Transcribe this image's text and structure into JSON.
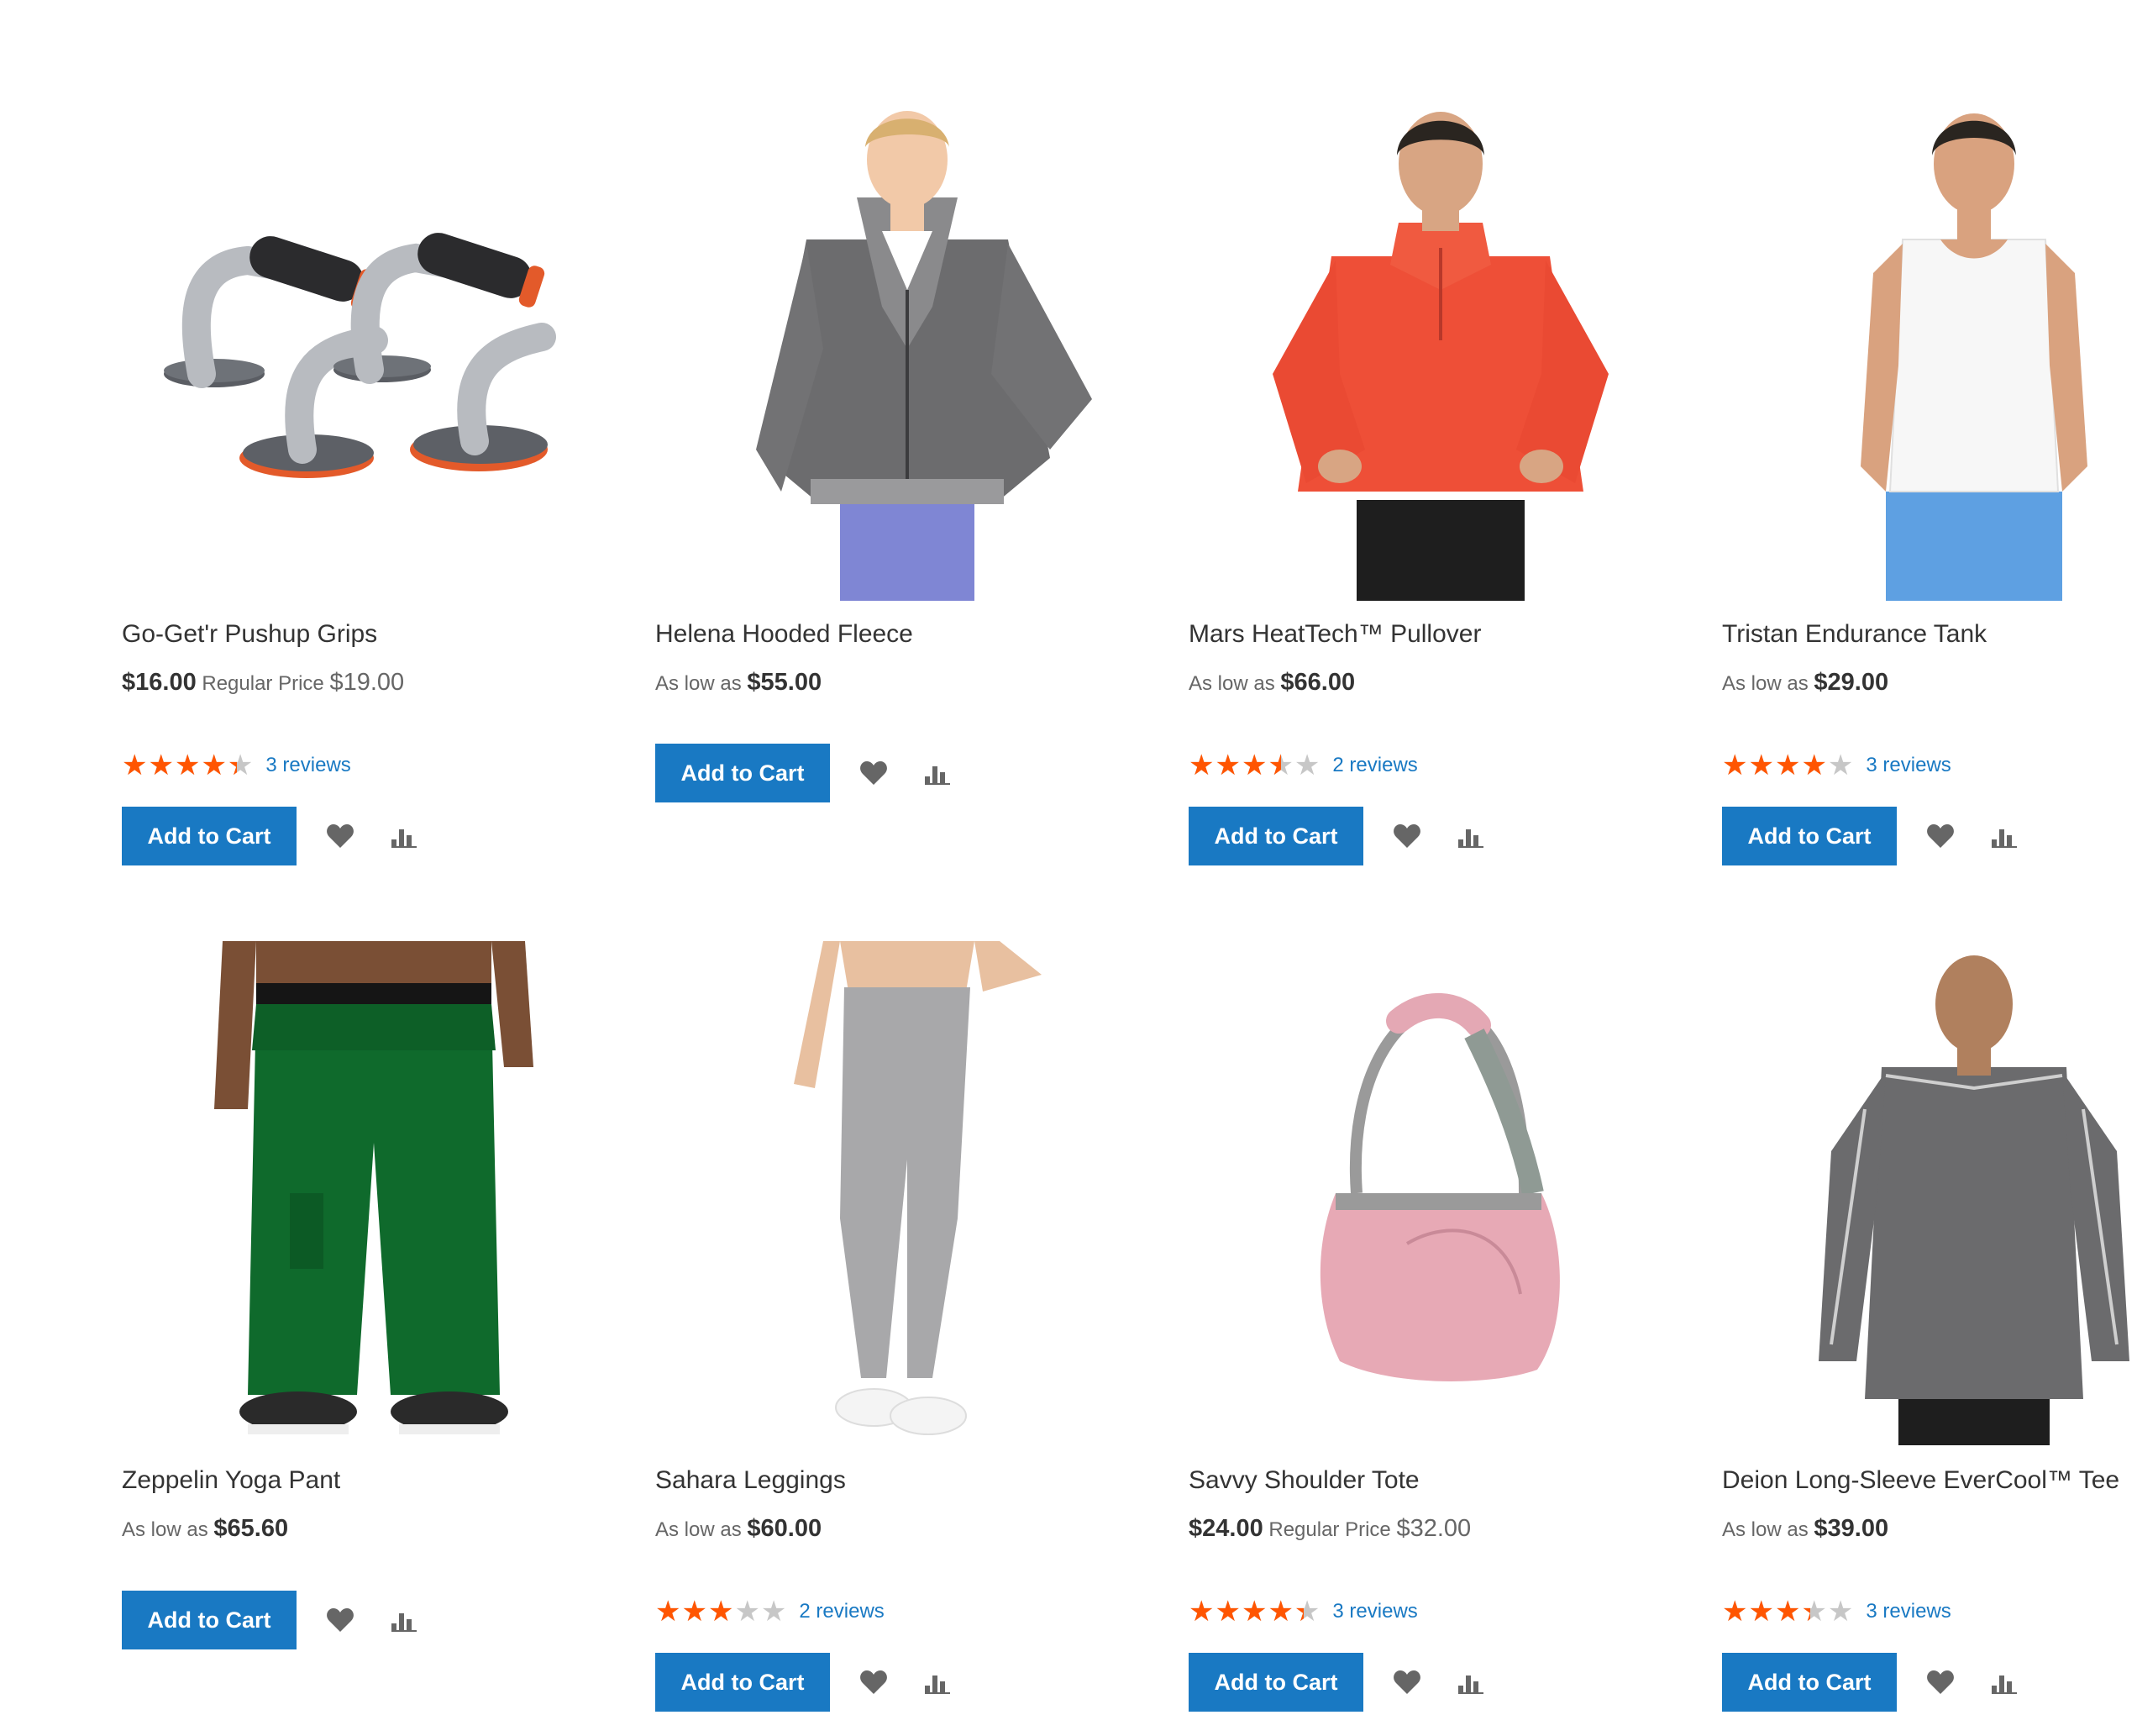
{
  "products": [
    {
      "name": "Go-Get'r Pushup Grips",
      "price_type": "special",
      "final_price": "$16.00",
      "regular_label": "Regular Price",
      "regular_price": "$19.00",
      "rating_percent": 87,
      "reviews": "3 reviews",
      "add_label": "Add to Cart",
      "image_icon": "pushup-grips-image"
    },
    {
      "name": "Helena Hooded Fleece",
      "price_type": "as-low-as",
      "as_low_label": "As low as",
      "final_price": "$55.00",
      "rating_percent": null,
      "reviews": "",
      "add_label": "Add to Cart",
      "image_icon": "hooded-fleece-image"
    },
    {
      "name": "Mars HeatTech™ Pullover",
      "price_type": "as-low-as",
      "as_low_label": "As low as",
      "final_price": "$66.00",
      "rating_percent": 70,
      "reviews": "2 reviews",
      "add_label": "Add to Cart",
      "image_icon": "pullover-image"
    },
    {
      "name": "Tristan Endurance Tank",
      "price_type": "as-low-as",
      "as_low_label": "As low as",
      "final_price": "$29.00",
      "rating_percent": 80,
      "reviews": "3 reviews",
      "add_label": "Add to Cart",
      "image_icon": "tank-image"
    },
    {
      "name": "Zeppelin Yoga Pant",
      "price_type": "as-low-as",
      "as_low_label": "As low as",
      "final_price": "$65.60",
      "rating_percent": null,
      "reviews": "",
      "add_label": "Add to Cart",
      "image_icon": "yoga-pant-image"
    },
    {
      "name": "Sahara Leggings",
      "price_type": "as-low-as",
      "as_low_label": "As low as",
      "final_price": "$60.00",
      "rating_percent": 60,
      "reviews": "2 reviews",
      "add_label": "Add to Cart",
      "image_icon": "leggings-image"
    },
    {
      "name": "Savvy Shoulder Tote",
      "price_type": "special",
      "final_price": "$24.00",
      "regular_label": "Regular Price",
      "regular_price": "$32.00",
      "rating_percent": 87,
      "reviews": "3 reviews",
      "add_label": "Add to Cart",
      "image_icon": "shoulder-tote-image"
    },
    {
      "name": "Deion Long-Sleeve EverCool™ Tee",
      "price_type": "as-low-as",
      "as_low_label": "As low as",
      "final_price": "$39.00",
      "rating_percent": 67,
      "reviews": "3 reviews",
      "add_label": "Add to Cart",
      "image_icon": "long-sleeve-tee-image"
    }
  ],
  "colors": {
    "button": "#1979c3",
    "star": "#ff5501",
    "star_empty": "#c7c7c7",
    "link": "#1979c3",
    "icon": "#666666"
  }
}
